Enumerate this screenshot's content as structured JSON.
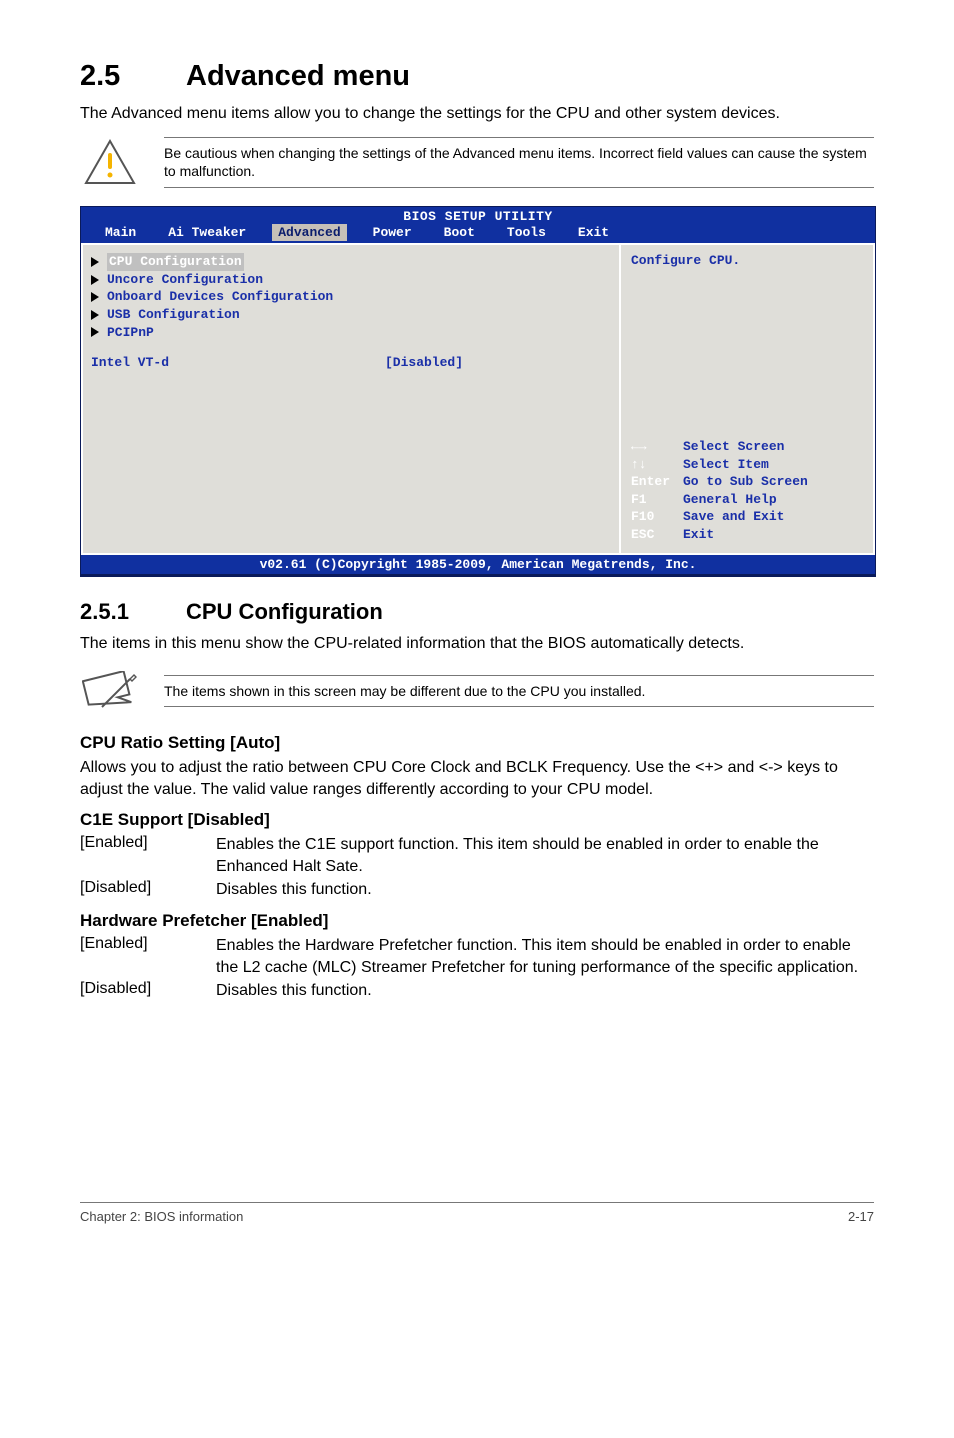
{
  "section": {
    "number": "2.5",
    "title": "Advanced menu"
  },
  "intro": "The Advanced menu items allow you to change the settings for the CPU and other system devices.",
  "caution": "Be cautious when changing the settings of the Advanced menu items. Incorrect field values can cause the system to malfunction.",
  "bios": {
    "title": "BIOS SETUP UTILITY",
    "tabs": {
      "main": "Main",
      "tweaker": "Ai Tweaker",
      "advanced": "Advanced",
      "power": "Power",
      "boot": "Boot",
      "tools": "Tools",
      "exit": "Exit"
    },
    "menu": {
      "cpu": "CPU Configuration",
      "uncore": "Uncore Configuration",
      "onboard": "Onboard Devices Configuration",
      "usb": "USB Configuration",
      "pcipnp": "PCIPnP"
    },
    "setting": {
      "label": "Intel VT-d",
      "value": "[Disabled]"
    },
    "right": {
      "heading": "Configure CPU.",
      "help": {
        "l1a": "←→",
        "l1b": "Select Screen",
        "l2a": "↑↓",
        "l2b": "Select Item",
        "l3a": "Enter",
        "l3b": "Go to Sub Screen",
        "l4a": "F1",
        "l4b": "General Help",
        "l5a": "F10",
        "l5b": "Save and Exit",
        "l6a": "ESC",
        "l6b": "Exit"
      }
    },
    "footer": "v02.61 (C)Copyright 1985-2009, American Megatrends, Inc."
  },
  "sub": {
    "number": "2.5.1",
    "title": "CPU Configuration"
  },
  "sub_intro": "The items in this menu show the CPU-related information that the BIOS automatically detects.",
  "note": "The items shown in this screen may be different due to the CPU you installed.",
  "cpuRatio": {
    "heading": "CPU Ratio Setting [Auto]",
    "body": "Allows you to adjust the ratio between CPU Core Clock and BCLK Frequency. Use the <+> and <-> keys to adjust the value. The valid value ranges differently according to your CPU model."
  },
  "c1e": {
    "heading": "C1E Support [Disabled]",
    "enabled_key": "[Enabled]",
    "enabled_val": "Enables the C1E support function. This item should be enabled in order to enable the Enhanced Halt Sate.",
    "disabled_key": "[Disabled]",
    "disabled_val": "Disables this function."
  },
  "hw": {
    "heading": "Hardware Prefetcher [Enabled]",
    "enabled_key": "[Enabled]",
    "enabled_val": "Enables the Hardware Prefetcher function. This item should be enabled in order to enable the L2 cache (MLC) Streamer Prefetcher for tuning performance of the specific application.",
    "disabled_key": "[Disabled]",
    "disabled_val": "Disables this function."
  },
  "footer": {
    "left": "Chapter 2: BIOS information",
    "right": "2-17"
  }
}
